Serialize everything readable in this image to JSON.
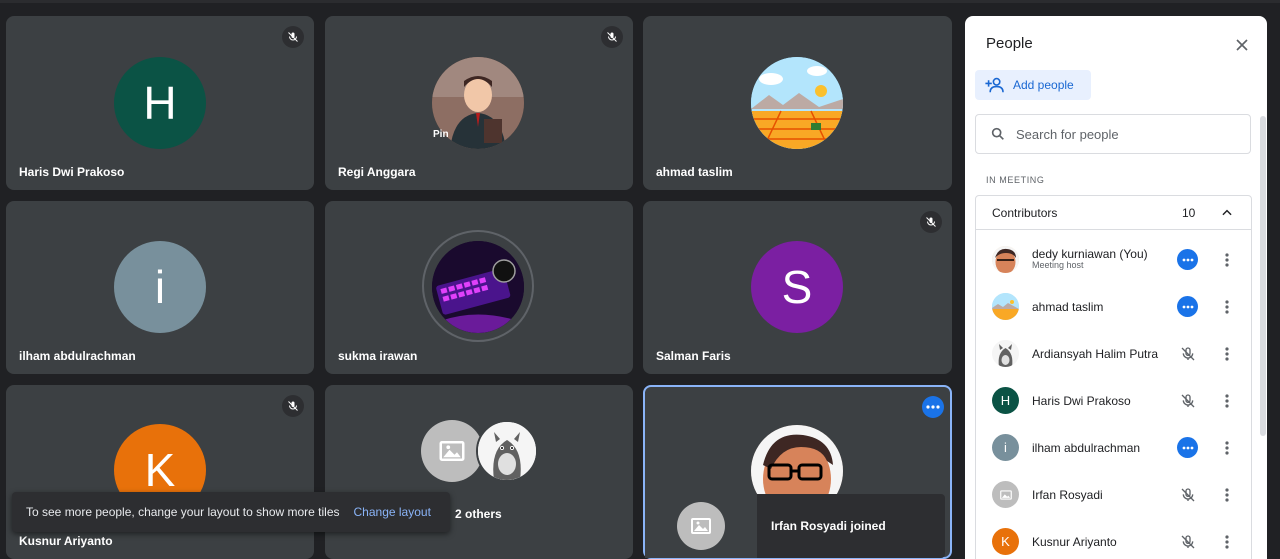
{
  "tiles": [
    {
      "name": "Haris Dwi Prakoso",
      "initial": "H",
      "color": "#0b5345",
      "muted": true
    },
    {
      "name": "Regi Anggara",
      "muted": true,
      "pin_label": "Pin"
    },
    {
      "name": "ahmad taslim",
      "muted": false
    },
    {
      "name": "ilham abdulrachman",
      "initial": "i",
      "color": "#78909c",
      "muted": false
    },
    {
      "name": "sukma irawan",
      "muted": false
    },
    {
      "name": "Salman Faris",
      "initial": "S",
      "color": "#7b1fa2",
      "muted": true
    },
    {
      "name": "Kusnur Ariyanto",
      "initial": "K",
      "color": "#e8710a",
      "muted": true
    },
    {
      "name": "2 others",
      "muted": false
    },
    {
      "name": "Irfan Rosyadi",
      "muted": false
    }
  ],
  "toast": {
    "message": "To see more people, change your layout to show more tiles",
    "action": "Change layout"
  },
  "join_notice": {
    "text": "Irfan Rosyadi joined"
  },
  "panel": {
    "title": "People",
    "add_people": "Add people",
    "search_placeholder": "Search for people",
    "section_label": "IN MEETING",
    "group_label": "Contributors",
    "group_count": "10",
    "participants": [
      {
        "name": "dedy kurniawan (You)",
        "sub": "Meeting host",
        "status": "more"
      },
      {
        "name": "ahmad taslim",
        "status": "more"
      },
      {
        "name": "Ardiansyah Halim Putra",
        "status": "muted"
      },
      {
        "name": "Haris Dwi Prakoso",
        "initial": "H",
        "color": "#0b5345",
        "status": "muted"
      },
      {
        "name": "ilham abdulrachman",
        "initial": "i",
        "color": "#78909c",
        "status": "more"
      },
      {
        "name": "Irfan Rosyadi",
        "status": "muted"
      },
      {
        "name": "Kusnur Ariyanto",
        "initial": "K",
        "color": "#e8710a",
        "status": "muted"
      }
    ]
  }
}
